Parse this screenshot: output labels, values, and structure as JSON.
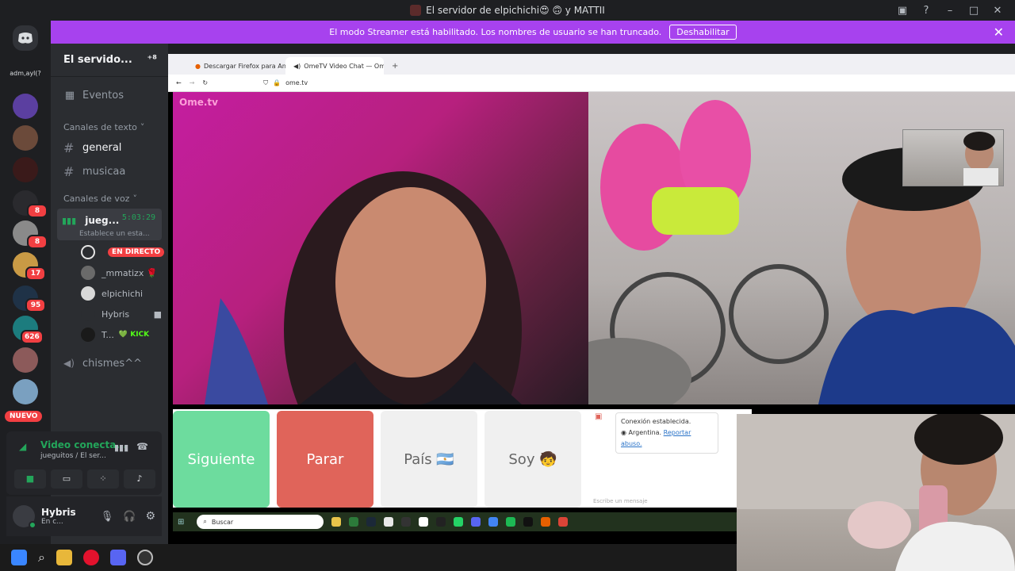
{
  "titlebar": {
    "title": "El servidor de elpichichi😍 🙃 y MATTII"
  },
  "banner": {
    "text": "El modo Streamer está habilitado. Los nombres de usuario se han truncado.",
    "button": "Deshabilitar",
    "close": "✕"
  },
  "guilds": {
    "first_label": "adm,ayl(?",
    "badges": [
      "8",
      "8",
      "17",
      "95",
      "626"
    ],
    "nuevo": "NUEVO"
  },
  "sidebar": {
    "server_name": "El servido...",
    "events": "Eventos",
    "text_category": "Canales de texto",
    "text_channels": [
      "general",
      "musicaa"
    ],
    "voice_category": "Canales de voz",
    "active_voice": {
      "name": "jueg...",
      "timer": "5:03:29",
      "status": "Establece un esta..."
    },
    "members": [
      {
        "name": "",
        "badge": "EN DIRECTO"
      },
      {
        "name": "_mmatizx 🌹"
      },
      {
        "name": "elpichichi"
      },
      {
        "name": "Hybris"
      },
      {
        "name": "T...",
        "badge": "💚 KICK"
      }
    ],
    "other_voice": "chismes^^"
  },
  "voice_panel": {
    "title": "Video conecta...",
    "subtitle": "jueguitos / El ser..."
  },
  "user_panel": {
    "name": "Hybris",
    "status": "En c..."
  },
  "browser": {
    "tabs": [
      "Descargar Firefox para Android",
      "OmeTV Video Chat — Ome..."
    ],
    "url": "ome.tv"
  },
  "ometv": {
    "logo": "Ome.tv",
    "buttons": {
      "next": "Siguiente",
      "stop": "Parar",
      "country": "País 🇦🇷",
      "gender": "Soy 🧒"
    },
    "chat": {
      "message": "Conexión establecida.",
      "country_line": "Argentina.",
      "report": "Reportar abuso.",
      "placeholder": "Escribe un mensaje"
    }
  },
  "inner_taskbar": {
    "search": "Buscar"
  },
  "colors": {
    "accent_banner": "#a742ee",
    "next_button": "#6ddc9e",
    "stop_button": "#e0645a",
    "discord_bg": "#1e1f22"
  }
}
